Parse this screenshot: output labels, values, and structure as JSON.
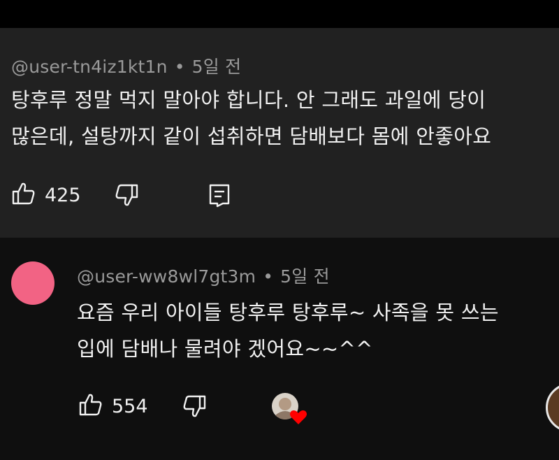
{
  "comment": {
    "username": "@user-tn4iz1kt1n",
    "separator": "•",
    "time": "5일 전",
    "lines": [
      "탕후루 정말 먹지 말아야 합니다. 안 그래도 과일에 당이",
      "많은데, 설탕까지 같이 섭취하면 담배보다 몸에 안좋아요"
    ],
    "like_count": "425",
    "icons": [
      "thumbs-up-icon",
      "thumbs-down-icon",
      "reply-icon"
    ]
  },
  "reply": {
    "username": "@user-ww8wl7gt3m",
    "separator": "•",
    "time": "5일 전",
    "lines": [
      "요즘 우리 아이들 탕후루 탕후루~ 사족을 못 쓰는",
      "입에 담배나 물려야 겠어요~~^^"
    ],
    "like_count": "554",
    "icons": [
      "thumbs-up-icon",
      "thumbs-down-icon",
      "creator-heart-icon",
      "avatar-icon"
    ]
  },
  "colors": {
    "comment_bg": "#212121",
    "reply_bg": "#0f0f0f",
    "meta_text": "#9a9a9a",
    "body_text": "#f1f1f1",
    "avatar_pink": "#f26384",
    "heart_red": "#ff0000"
  }
}
